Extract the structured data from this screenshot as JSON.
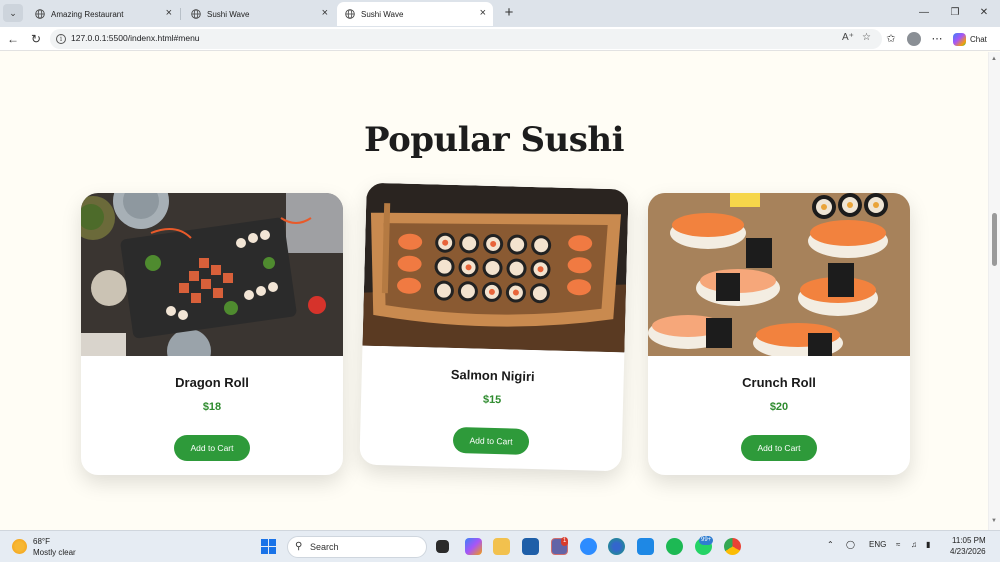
{
  "browser": {
    "tabs": [
      {
        "title": "Amazing Restaurant",
        "active": false
      },
      {
        "title": "Sushi Wave",
        "active": false
      },
      {
        "title": "Sushi Wave",
        "active": true
      }
    ],
    "url": "127.0.0.1:5500/indenx.html#menu",
    "chat_label": "Chat"
  },
  "page": {
    "section_title": "Popular Sushi",
    "cards": [
      {
        "name": "Dragon Roll",
        "price": "$18",
        "button": "Add to Cart"
      },
      {
        "name": "Salmon Nigiri",
        "price": "$15",
        "button": "Add to Cart"
      },
      {
        "name": "Crunch Roll",
        "price": "$20",
        "button": "Add to Cart"
      }
    ],
    "colors": {
      "price": "#2e8b2e",
      "button": "#2e9a3a",
      "background": "#fffdf5"
    }
  },
  "taskbar": {
    "weather_temp": "68°F",
    "weather_desc": "Mostly clear",
    "search_label": "Search",
    "teams_badge": "1",
    "whatsapp_badge": "99+",
    "language": "ENG",
    "time": "11:05 PM",
    "date": "4/23/2026"
  }
}
